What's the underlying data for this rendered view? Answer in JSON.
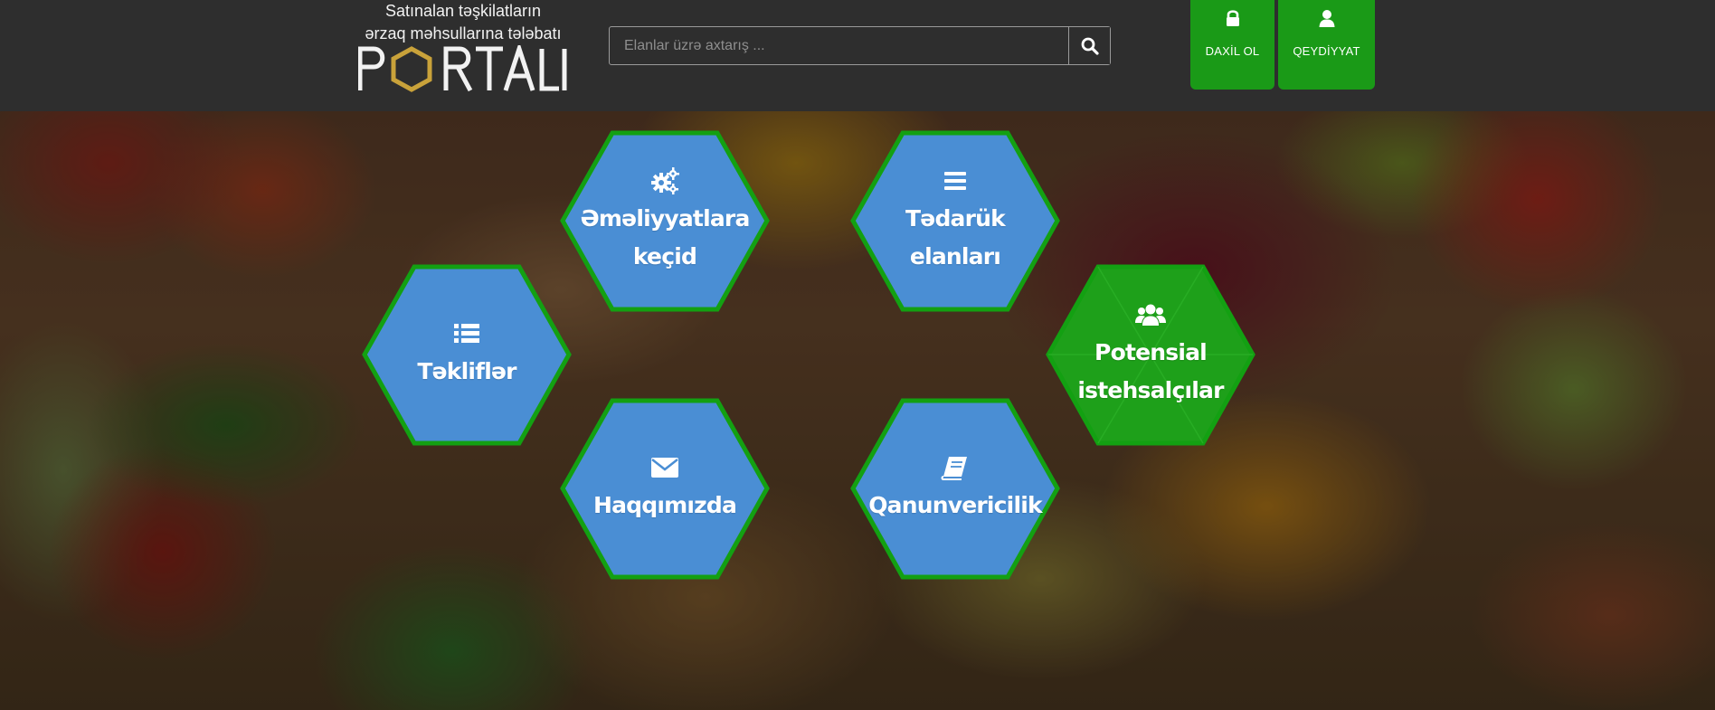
{
  "header": {
    "brand": {
      "line1": "Satınalan təşkilatların",
      "line2": "ərzaq məhsullarına tələbatı",
      "word": "PORTALI",
      "logo_accent_color": "#c9a23a"
    },
    "search": {
      "placeholder": "Elanlar üzrə axtarış ...",
      "value": "",
      "button_icon": "search-icon"
    },
    "login": {
      "label": "DAXİL OL",
      "icon": "lock-icon"
    },
    "register": {
      "label": "QEYDİYYAT",
      "icon": "user-icon"
    }
  },
  "tiles": [
    {
      "label_lines": [
        "Əməliyyatlara",
        "keçid"
      ],
      "icon": "cogs-icon",
      "color": "#4a8ed4"
    },
    {
      "label_lines": [
        "Tədarük elanları"
      ],
      "icon": "bars-icon",
      "color": "#4a8ed4"
    },
    {
      "label_lines": [
        "Təkliflər"
      ],
      "icon": "list-icon",
      "color": "#4a8ed4"
    },
    {
      "label_lines": [
        "Potensial",
        "istehsalçılar"
      ],
      "icon": "users-icon",
      "color": "#1ea01a"
    },
    {
      "label_lines": [
        "Haqqımızda"
      ],
      "icon": "envelope-icon",
      "color": "#4a8ed4"
    },
    {
      "label_lines": [
        "Qanunvericilik"
      ],
      "icon": "book-icon",
      "color": "#4a8ed4"
    }
  ],
  "colors": {
    "header_bg": "#2e2e2e",
    "accent_green": "#1a9a17",
    "hex_blue": "#4a8ed4",
    "hex_border": "#13a012"
  }
}
